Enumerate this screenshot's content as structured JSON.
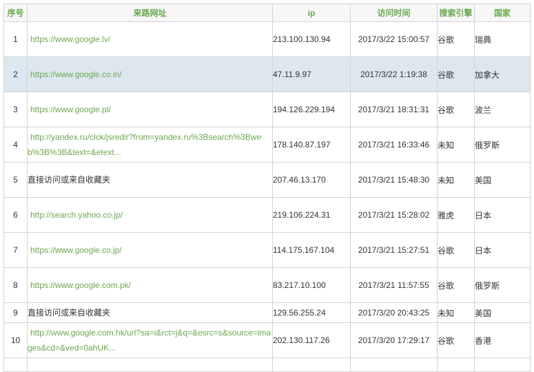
{
  "headers": {
    "no": "序号",
    "url": "来路网址",
    "ip": "ip",
    "time": "访问时间",
    "engine": "搜索引擎",
    "country": "国家"
  },
  "rows": [
    {
      "no": "1",
      "url": "https://www.google.lv/",
      "is_link": true,
      "ip": "213.100.130.94",
      "time": "2017/3/22 15:00:57",
      "engine": "谷歌",
      "country": "瑞典"
    },
    {
      "no": "2",
      "url": "https://www.google.co.in/",
      "is_link": true,
      "ip": "47.11.9.97",
      "time": "2017/3/22 1:19:38",
      "engine": "谷歌",
      "country": "加拿大"
    },
    {
      "no": "3",
      "url": "https://www.google.pl/",
      "is_link": true,
      "ip": "194.126.229.194",
      "time": "2017/3/21 18:31:31",
      "engine": "谷歌",
      "country": "波兰"
    },
    {
      "no": "4",
      "url": "http://yandex.ru/clck/jsredir?from=yandex.ru%3Bsearch%3Bweb%3B%3B&text=&etext...",
      "is_link": true,
      "ip": "178.140.87.197",
      "time": "2017/3/21 16:33:46",
      "engine": "未知",
      "country": "俄罗斯"
    },
    {
      "no": "5",
      "url": "直接访问或来自收藏夹",
      "is_link": false,
      "ip": "207.46.13.170",
      "time": "2017/3/21 15:48:30",
      "engine": "未知",
      "country": "美国"
    },
    {
      "no": "6",
      "url": "http://search.yahoo.co.jp/",
      "is_link": true,
      "ip": "219.106.224.31",
      "time": "2017/3/21 15:28:02",
      "engine": "雅虎",
      "country": "日本"
    },
    {
      "no": "7",
      "url": "https://www.google.co.jp/",
      "is_link": true,
      "ip": "114.175.167.104",
      "time": "2017/3/21 15:27:51",
      "engine": "谷歌",
      "country": "日本"
    },
    {
      "no": "8",
      "url": "https://www.google.com.pk/",
      "is_link": true,
      "ip": "83.217.10.100",
      "time": "2017/3/21 11:57:55",
      "engine": "谷歌",
      "country": "俄罗斯"
    },
    {
      "no": "9",
      "url": "直接访问或来自收藏夹",
      "is_link": false,
      "ip": "129.56.255.24",
      "time": "2017/3/20 20:43:25",
      "engine": "未知",
      "country": "美国"
    },
    {
      "no": "10",
      "url": "http://www.google.com.hk/url?sa=i&rct=j&q=&esrc=s&source=images&cd=&ved=0ahUK...",
      "is_link": true,
      "ip": "202.130.117.26",
      "time": "2017/3/20 17:29:17",
      "engine": "谷歌",
      "country": "香港"
    }
  ],
  "selected_row": 2,
  "colors": {
    "header_text": "#6aa84f",
    "link": "#6aa84f",
    "selected_row_bg": "#dde7ef",
    "border": "#d3d3d3"
  }
}
